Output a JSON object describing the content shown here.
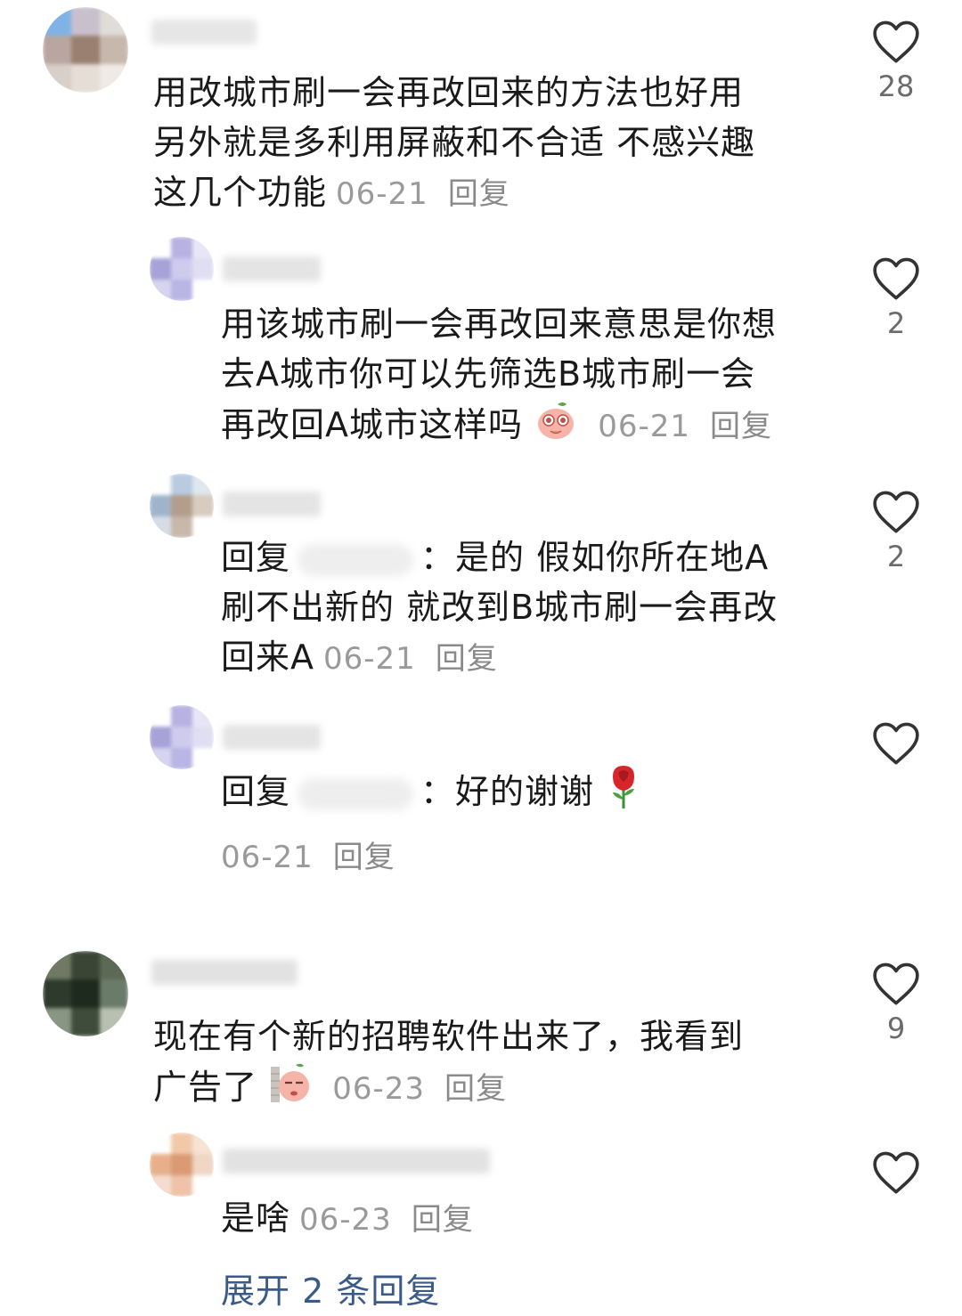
{
  "comments": [
    {
      "text_lines": [
        "用改城市刷一会再改回来的方法也好用",
        "另外就是多利用屏蔽和不合适 不感兴趣",
        "这几个功能"
      ],
      "date": "06-21",
      "reply": "回复",
      "likes": "28"
    },
    {
      "text_lines": [
        "用该城市刷一会再改回来意思是你想",
        "去A城市你可以先筛选B城市刷一会",
        "再改回A城市这样吗"
      ],
      "emoji": "peach-pleading-emoji",
      "date": "06-21",
      "reply": "回复",
      "likes": "2"
    },
    {
      "prefix": "回复",
      "colon": "：",
      "text_lines": [
        "是的 假如你所在地A",
        "刷不出新的 就改到B城市刷一会再改",
        "回来A"
      ],
      "date": "06-21",
      "reply": "回复",
      "likes": "2"
    },
    {
      "prefix": "回复",
      "colon": "：",
      "text_lines": [
        "好的谢谢"
      ],
      "emoji": "rose-emoji",
      "date": "06-21",
      "reply": "回复",
      "likes": ""
    },
    {
      "text_lines": [
        "现在有个新的招聘软件出来了，我看到",
        "广告了"
      ],
      "emoji": "peach-peek-emoji",
      "date": "06-23",
      "reply": "回复",
      "likes": "9"
    },
    {
      "text_lines": [
        "是啥"
      ],
      "date": "06-23",
      "reply": "回复",
      "likes": ""
    }
  ],
  "expand_partial": "展开 2 条回复",
  "icons": {
    "like": "heart-outline-icon"
  },
  "colors": {
    "text": "#1a1a1a",
    "meta": "#9a9a9a",
    "like_count": "#6b6b6b"
  }
}
